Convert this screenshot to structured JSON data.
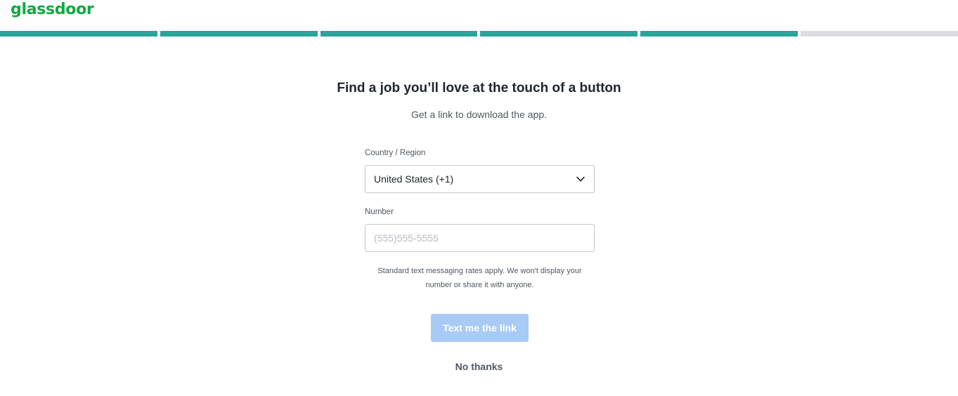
{
  "brand": {
    "name": "glassdoor",
    "color": "#0caa41"
  },
  "progress": {
    "total_steps": 6,
    "completed_steps": 5,
    "done_color": "#2aa39c",
    "pending_color": "#dcdde0"
  },
  "main": {
    "title": "Find a job you’ll love at the touch of a button",
    "subtitle": "Get a link to download the app."
  },
  "form": {
    "country": {
      "label": "Country / Region",
      "value": "United States (+1)",
      "icon": "chevron-down-icon"
    },
    "number": {
      "label": "Number",
      "value": "",
      "placeholder": "(555)555-5555"
    },
    "disclaimer": "Standard text messaging rates apply. We won't display your number or share it with anyone.",
    "submit_label": "Text me the link",
    "submit_color": "#a8cbf6",
    "decline_label": "No thanks"
  }
}
